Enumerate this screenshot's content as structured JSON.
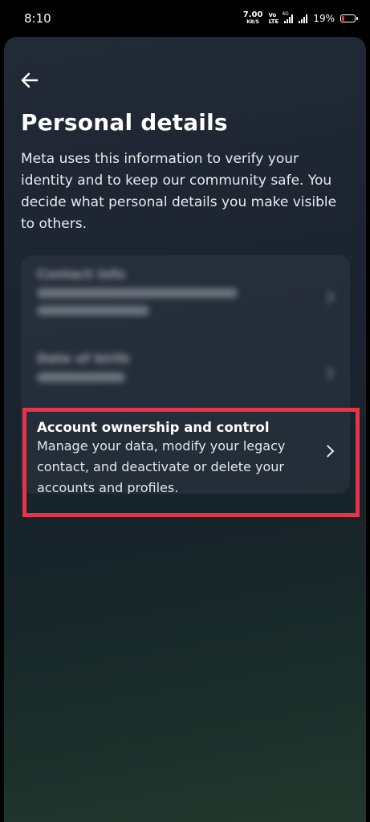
{
  "status_bar": {
    "time": "8:10",
    "net_speed": "7.00",
    "net_unit": "KB/S",
    "volte_top": "Vo",
    "volte_bottom": "LTE",
    "network_tag": "4G",
    "battery_percent": "19%",
    "battery_level": 0.19,
    "battery_color": "#e53935"
  },
  "header": {
    "back_icon": "arrow-left-icon",
    "title": "Personal details"
  },
  "description": "Meta uses this information to verify your identity and to keep our community safe. You decide what personal details you make visible to others.",
  "items": [
    {
      "title": "Contact info",
      "subtitle": "",
      "blurred": true
    },
    {
      "title": "Date of birth",
      "subtitle": "",
      "blurred": true
    },
    {
      "title": "Account ownership and control",
      "subtitle": "Manage your data, modify your legacy contact, and deactivate or delete your accounts and profiles.",
      "chevron_icon": "chevron-right-icon"
    }
  ],
  "colors": {
    "highlight": "#e8334a",
    "accent_text": "#ffffff"
  }
}
